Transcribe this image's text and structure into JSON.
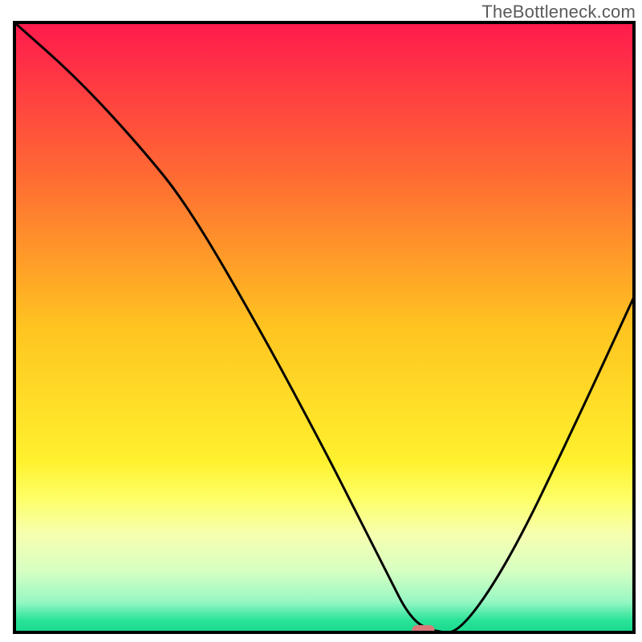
{
  "watermark": "TheBottleneck.com",
  "chart_data": {
    "type": "line",
    "title": "",
    "xlabel": "",
    "ylabel": "",
    "xlim": [
      0,
      100
    ],
    "ylim": [
      0,
      100
    ],
    "grid": false,
    "legend": false,
    "background_gradient": {
      "stops": [
        {
          "offset": 0.0,
          "color": "#ff1a4d"
        },
        {
          "offset": 0.25,
          "color": "#ff6a33"
        },
        {
          "offset": 0.5,
          "color": "#ffc420"
        },
        {
          "offset": 0.72,
          "color": "#fff12e"
        },
        {
          "offset": 0.78,
          "color": "#feff66"
        },
        {
          "offset": 0.84,
          "color": "#f6ffb0"
        },
        {
          "offset": 0.9,
          "color": "#d6ffc2"
        },
        {
          "offset": 0.95,
          "color": "#96f7c3"
        },
        {
          "offset": 0.98,
          "color": "#2be39a"
        },
        {
          "offset": 1.0,
          "color": "#17d98c"
        }
      ]
    },
    "series": [
      {
        "name": "bottleneck-curve",
        "x": [
          0,
          10,
          20,
          28,
          40,
          50,
          55,
          60,
          64,
          68,
          72,
          80,
          90,
          100
        ],
        "y": [
          100,
          91,
          80,
          70,
          49,
          30,
          20,
          10,
          2,
          0,
          0,
          12,
          33,
          55
        ]
      }
    ],
    "marker": {
      "name": "optimal-point",
      "x": 66,
      "y": 0,
      "color": "#d97a7a",
      "shape": "rounded-rect"
    },
    "frame_stroke": "#000000",
    "frame_stroke_width": 4
  }
}
